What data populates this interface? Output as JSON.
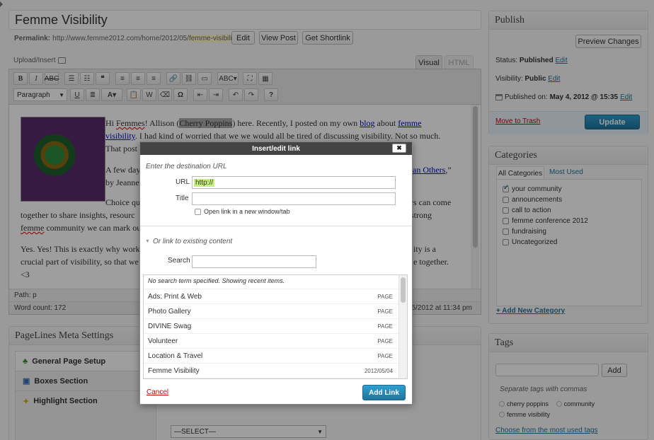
{
  "post": {
    "title": "Femme Visibility",
    "permalink_label": "Permalink:",
    "permalink_base": "http://www.femme2012.com/home/2012/05/",
    "permalink_slug": "femme-visibility",
    "permalink_end": "/",
    "edit_btn": "Edit",
    "view_post_btn": "View Post",
    "shortlink_btn": "Get Shortlink"
  },
  "editor": {
    "upload_label": "Upload/Insert",
    "tab_visual": "Visual",
    "tab_html": "HTML",
    "format_select": "Paragraph",
    "path": "Path: p",
    "word_count": "Word count: 172",
    "last_edited": "5/2012 at 11:34 pm",
    "p1": [
      "Hi ",
      "Femmes",
      "! Allison (",
      "Cherry Poppins",
      ") here. Recently, I posted on my own ",
      "blog",
      " about ",
      "femme",
      "visibility",
      ". I had kind of worried that we we would all be tired of discussing visibility. Not so much.",
      "That post"
    ],
    "p2": [
      "A few day",
      "an Others",
      ",”",
      "by Jeanne"
    ],
    "p3": [
      "Choice qu",
      "rs can come",
      "together to share insights, resourc",
      "strong",
      "femme",
      " community we can mark ou"
    ],
    "p4": [
      "Yes. Yes! This is exactly why worki",
      "ity is a",
      "crucial part of visibility, so that we",
      "e together.",
      "<3"
    ]
  },
  "publish": {
    "title": "Publish",
    "preview_btn": "Preview Changes",
    "status_label": "Status:",
    "status_value": "Published",
    "visibility_label": "Visibility:",
    "visibility_value": "Public",
    "published_label": "Published on:",
    "published_value": "May 4, 2012 @ 15:35",
    "edit": "Edit",
    "trash": "Move to Trash",
    "update_btn": "Update"
  },
  "categories": {
    "title": "Categories",
    "tab_all": "All Categories",
    "tab_used": "Most Used",
    "items": [
      {
        "label": "your community",
        "checked": true
      },
      {
        "label": "announcements",
        "checked": false
      },
      {
        "label": "call to action",
        "checked": false
      },
      {
        "label": "femme conference 2012",
        "checked": false
      },
      {
        "label": "fundraising",
        "checked": false
      },
      {
        "label": "Uncategorized",
        "checked": false
      }
    ],
    "add_new": "+ Add New Category"
  },
  "tags": {
    "title": "Tags",
    "add_btn": "Add",
    "hint": "Separate tags with commas",
    "items": [
      "cherry poppins",
      "community",
      "femme visibility"
    ],
    "choose_link": "Choose from the most used tags"
  },
  "pagelines": {
    "title": "PageLines Meta Settings",
    "items": [
      "General Page Setup",
      "Boxes Section",
      "Highlight Section"
    ],
    "select_value": "—SELECT—"
  },
  "dialog": {
    "title": "Insert/edit link",
    "close": "✖",
    "dest_label": "Enter the destination URL",
    "url_label": "URL",
    "url_value": "http://",
    "title_label": "Title",
    "title_value": "",
    "newtab_label": "Open link in a new window/tab",
    "existing_label": "Or link to existing content",
    "search_label": "Search",
    "search_value": "",
    "no_search_msg": "No search term specified. Showing recent items.",
    "results": [
      {
        "title": "Ads: Print & Web",
        "meta": "PAGE"
      },
      {
        "title": "Photo Gallery",
        "meta": "PAGE"
      },
      {
        "title": "DIVINE Swag",
        "meta": "PAGE"
      },
      {
        "title": "Volunteer",
        "meta": "PAGE"
      },
      {
        "title": "Location & Travel",
        "meta": "PAGE"
      },
      {
        "title": "Femme Visibility",
        "meta": "2012/05/04"
      }
    ],
    "cancel": "Cancel",
    "add_link_btn": "Add Link"
  },
  "colors": {
    "accent": "#21759b",
    "update_btn": "#21759b",
    "trash": "#bc0b0b",
    "overlay": "#000000",
    "url_highlight": "#c7f07a"
  }
}
